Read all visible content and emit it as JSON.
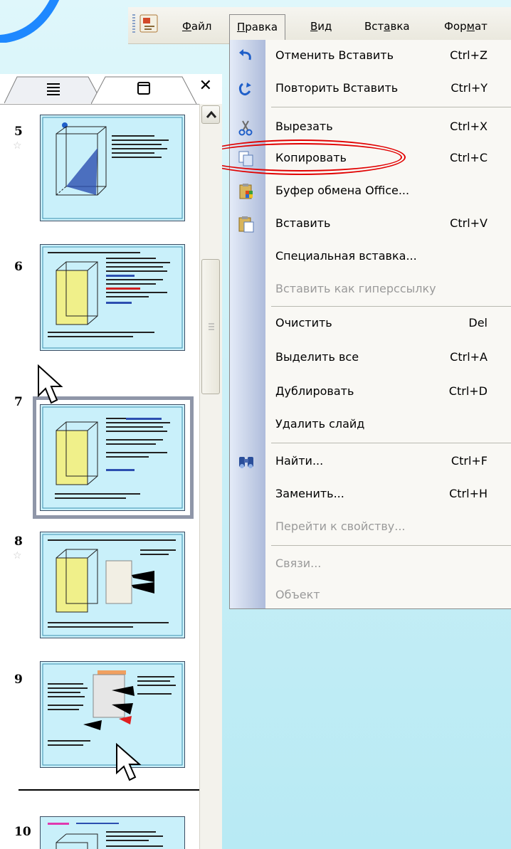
{
  "menubar": {
    "items": [
      {
        "label": "Файл",
        "accel": "Ф",
        "rest": "айл"
      },
      {
        "label": "Правка",
        "accel": "П",
        "rest": "равка"
      },
      {
        "label": "Вид",
        "accel": "В",
        "rest": "ид"
      },
      {
        "label": "Вставка",
        "pre": "Вст",
        "accel": "а",
        "rest": "вка"
      },
      {
        "label": "Формат",
        "pre": "Фор",
        "accel": "м",
        "rest": "ат"
      }
    ]
  },
  "edit_menu": {
    "items": [
      {
        "label": "Отменить Вставить",
        "shortcut": "Ctrl+Z",
        "icon": "undo-icon",
        "enabled": true
      },
      {
        "label": "Повторить Вставить",
        "shortcut": "Ctrl+Y",
        "icon": "redo-icon",
        "enabled": true
      },
      {
        "label": "Вырезать",
        "shortcut": "Ctrl+X",
        "icon": "scissors-icon",
        "enabled": true
      },
      {
        "label": "Копировать",
        "shortcut": "Ctrl+C",
        "icon": "copy-icon",
        "enabled": true,
        "highlighted": true
      },
      {
        "label": "Буфер обмена Office...",
        "shortcut": "",
        "icon": "clipboard-office-icon",
        "enabled": true
      },
      {
        "label": "Вставить",
        "shortcut": "Ctrl+V",
        "icon": "paste-icon",
        "enabled": true
      },
      {
        "label": "Специальная вставка...",
        "shortcut": "",
        "icon": "",
        "enabled": true
      },
      {
        "label": "Вставить как гиперссылку",
        "shortcut": "",
        "icon": "",
        "enabled": false
      },
      {
        "label": "Очистить",
        "shortcut": "Del",
        "icon": "",
        "enabled": true
      },
      {
        "label": "Выделить все",
        "shortcut": "Ctrl+A",
        "icon": "",
        "enabled": true
      },
      {
        "label": "Дублировать",
        "shortcut": "Ctrl+D",
        "icon": "",
        "enabled": true
      },
      {
        "label": "Удалить слайд",
        "shortcut": "",
        "icon": "",
        "enabled": true
      },
      {
        "label": "Найти...",
        "shortcut": "Ctrl+F",
        "icon": "binoculars-icon",
        "enabled": true
      },
      {
        "label": "Заменить...",
        "shortcut": "Ctrl+H",
        "icon": "",
        "enabled": true
      },
      {
        "label": "Перейти к свойству...",
        "shortcut": "",
        "icon": "",
        "enabled": false
      },
      {
        "label": "Связи...",
        "shortcut": "",
        "icon": "",
        "enabled": false
      },
      {
        "label": "Объект",
        "shortcut": "",
        "icon": "",
        "enabled": false
      }
    ]
  },
  "slides_pane": {
    "tabs": [
      {
        "name": "outline",
        "icon": "outline-icon"
      },
      {
        "name": "slides",
        "icon": "slides-icon"
      }
    ],
    "close_symbol": "✕",
    "slides": [
      {
        "number": "5",
        "has_transition": true
      },
      {
        "number": "6",
        "has_transition": false
      },
      {
        "number": "7",
        "has_transition": false,
        "selected": true
      },
      {
        "number": "8",
        "has_transition": true
      },
      {
        "number": "9",
        "has_transition": false
      },
      {
        "number": "10",
        "has_transition": false
      }
    ],
    "transition_star": "☆"
  },
  "colors": {
    "highlight": "#e10000",
    "slide_background": "#c9f0fa",
    "menu_rail": "#c4cfe6"
  }
}
